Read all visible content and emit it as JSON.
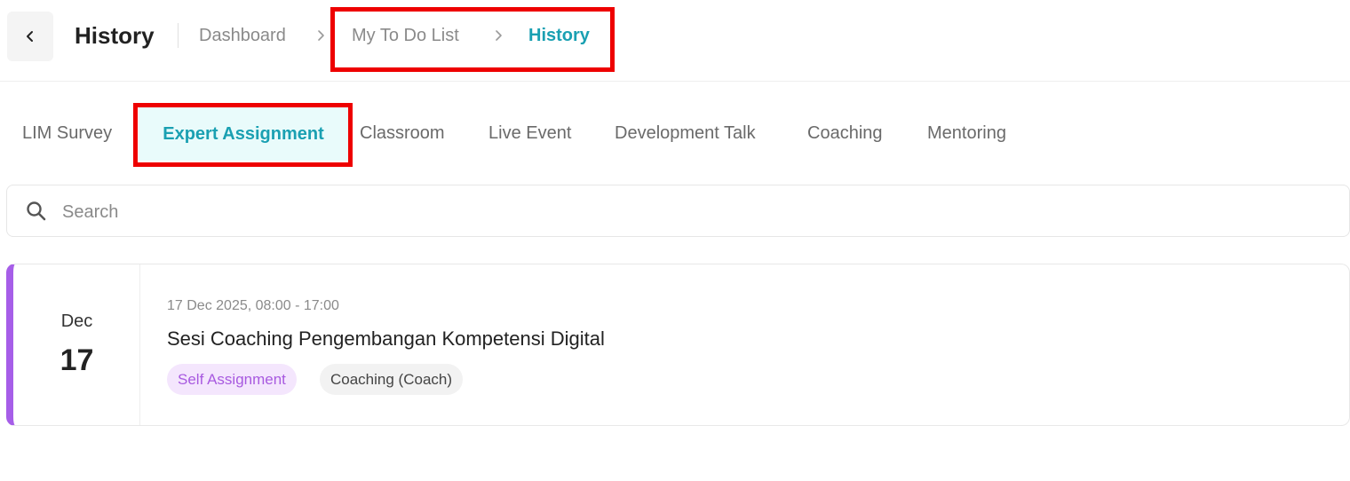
{
  "header": {
    "title": "History",
    "back_icon": "chevron-left-icon",
    "breadcrumb": [
      "Dashboard",
      "My To Do List",
      "History"
    ],
    "separator_icon": "chevron-right-icon"
  },
  "tabs": [
    {
      "label": "LIM Survey",
      "active": false
    },
    {
      "label": "Expert Assignment",
      "active": true
    },
    {
      "label": "Classroom",
      "active": false
    },
    {
      "label": "Live Event",
      "active": false
    },
    {
      "label": "Development Talk",
      "active": false
    },
    {
      "label": "Coaching",
      "active": false
    },
    {
      "label": "Mentoring",
      "active": false
    }
  ],
  "search": {
    "placeholder": "Search",
    "value": "",
    "icon": "search-icon"
  },
  "cards": [
    {
      "month": "Dec",
      "day": "17",
      "time": "17 Dec 2025, 08:00 - 17:00",
      "title": "Sesi Coaching Pengembangan Kompetensi Digital",
      "tags": [
        "Self Assignment",
        "Coaching (Coach)"
      ],
      "accent_color": "#a65ee8"
    }
  ],
  "colors": {
    "accent": "#1aa0b2",
    "active_tab_bg": "#e9fbfb",
    "highlight": "#ee0000",
    "purple_tag_bg": "#f4e6fd",
    "purple_tag_text": "#a85ae0"
  }
}
